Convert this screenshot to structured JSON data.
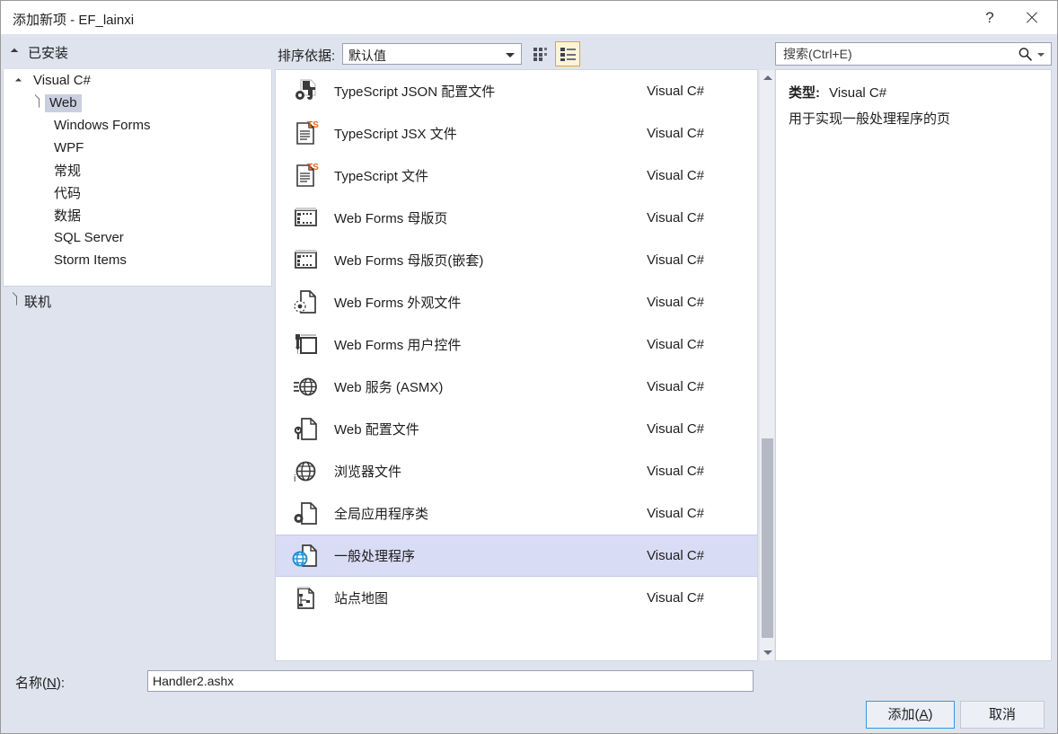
{
  "window": {
    "title": "添加新项 - EF_lainxi",
    "help_icon": "question-mark-icon",
    "close_icon": "close-icon"
  },
  "sidebar": {
    "header": "已安装",
    "tree": [
      {
        "label": "Visual C#",
        "level": 0,
        "twisty": "expanded",
        "selected": false
      },
      {
        "label": "Web",
        "level": 1,
        "twisty": "collapsed",
        "selected": true
      },
      {
        "label": "Windows Forms",
        "level": 1,
        "twisty": "none",
        "selected": false
      },
      {
        "label": "WPF",
        "level": 1,
        "twisty": "none",
        "selected": false
      },
      {
        "label": "常规",
        "level": 1,
        "twisty": "none",
        "selected": false
      },
      {
        "label": "代码",
        "level": 1,
        "twisty": "none",
        "selected": false
      },
      {
        "label": "数据",
        "level": 1,
        "twisty": "none",
        "selected": false
      },
      {
        "label": "SQL Server",
        "level": 1,
        "twisty": "none",
        "selected": false
      },
      {
        "label": "Storm Items",
        "level": 1,
        "twisty": "none",
        "selected": false
      }
    ],
    "online": "联机"
  },
  "toolbar": {
    "sort_label": "排序依据:",
    "sort_value": "默认值",
    "sort_options": [
      "默认值"
    ],
    "view_grid_icon": "grid-view-icon",
    "view_list_icon": "list-view-icon",
    "view_mode_selected": "list"
  },
  "search": {
    "placeholder": "搜索(Ctrl+E)",
    "value": "",
    "icon": "search-icon",
    "dropdown_icon": "chevron-down-icon"
  },
  "list": {
    "items": [
      {
        "name": "TypeScript JSON 配置文件",
        "lang": "Visual C#",
        "icon": "typescript-json-config-icon",
        "selected": false
      },
      {
        "name": "TypeScript JSX 文件",
        "lang": "Visual C#",
        "icon": "typescript-jsx-file-icon",
        "selected": false
      },
      {
        "name": "TypeScript 文件",
        "lang": "Visual C#",
        "icon": "typescript-file-icon",
        "selected": false
      },
      {
        "name": "Web Forms 母版页",
        "lang": "Visual C#",
        "icon": "master-page-icon",
        "selected": false
      },
      {
        "name": "Web Forms 母版页(嵌套)",
        "lang": "Visual C#",
        "icon": "nested-master-page-icon",
        "selected": false
      },
      {
        "name": "Web Forms 外观文件",
        "lang": "Visual C#",
        "icon": "skin-file-icon",
        "selected": false
      },
      {
        "name": "Web Forms 用户控件",
        "lang": "Visual C#",
        "icon": "user-control-icon",
        "selected": false
      },
      {
        "name": "Web 服务 (ASMX)",
        "lang": "Visual C#",
        "icon": "web-service-icon",
        "selected": false
      },
      {
        "name": "Web 配置文件",
        "lang": "Visual C#",
        "icon": "web-config-icon",
        "selected": false
      },
      {
        "name": "浏览器文件",
        "lang": "Visual C#",
        "icon": "browser-file-icon",
        "selected": false
      },
      {
        "name": "全局应用程序类",
        "lang": "Visual C#",
        "icon": "global-application-class-icon",
        "selected": false
      },
      {
        "name": "一般处理程序",
        "lang": "Visual C#",
        "icon": "generic-handler-icon",
        "selected": true
      },
      {
        "name": "站点地图",
        "lang": "Visual C#",
        "icon": "site-map-icon",
        "selected": false
      }
    ]
  },
  "detail": {
    "type_label": "类型:",
    "type_value": "Visual C#",
    "description": "用于实现一般处理程序的页"
  },
  "footer": {
    "name_label_prefix": "名称(",
    "name_label_accel": "N",
    "name_label_suffix": "):",
    "name_value": "Handler2.ashx",
    "add_prefix": "添加(",
    "add_accel": "A",
    "add_suffix": ")",
    "cancel_label": "取消"
  },
  "colors": {
    "dialog_bg": "#dfe3ee",
    "selection": "#d9dcf5",
    "tree_selection": "#c9cee0",
    "accent_button_border": "#3399dd",
    "viewmode_active_bg": "#fdf4d6",
    "viewmode_active_border": "#d9a441",
    "globe_blue": "#1e90d0",
    "ts_orange": "#e8641c"
  }
}
